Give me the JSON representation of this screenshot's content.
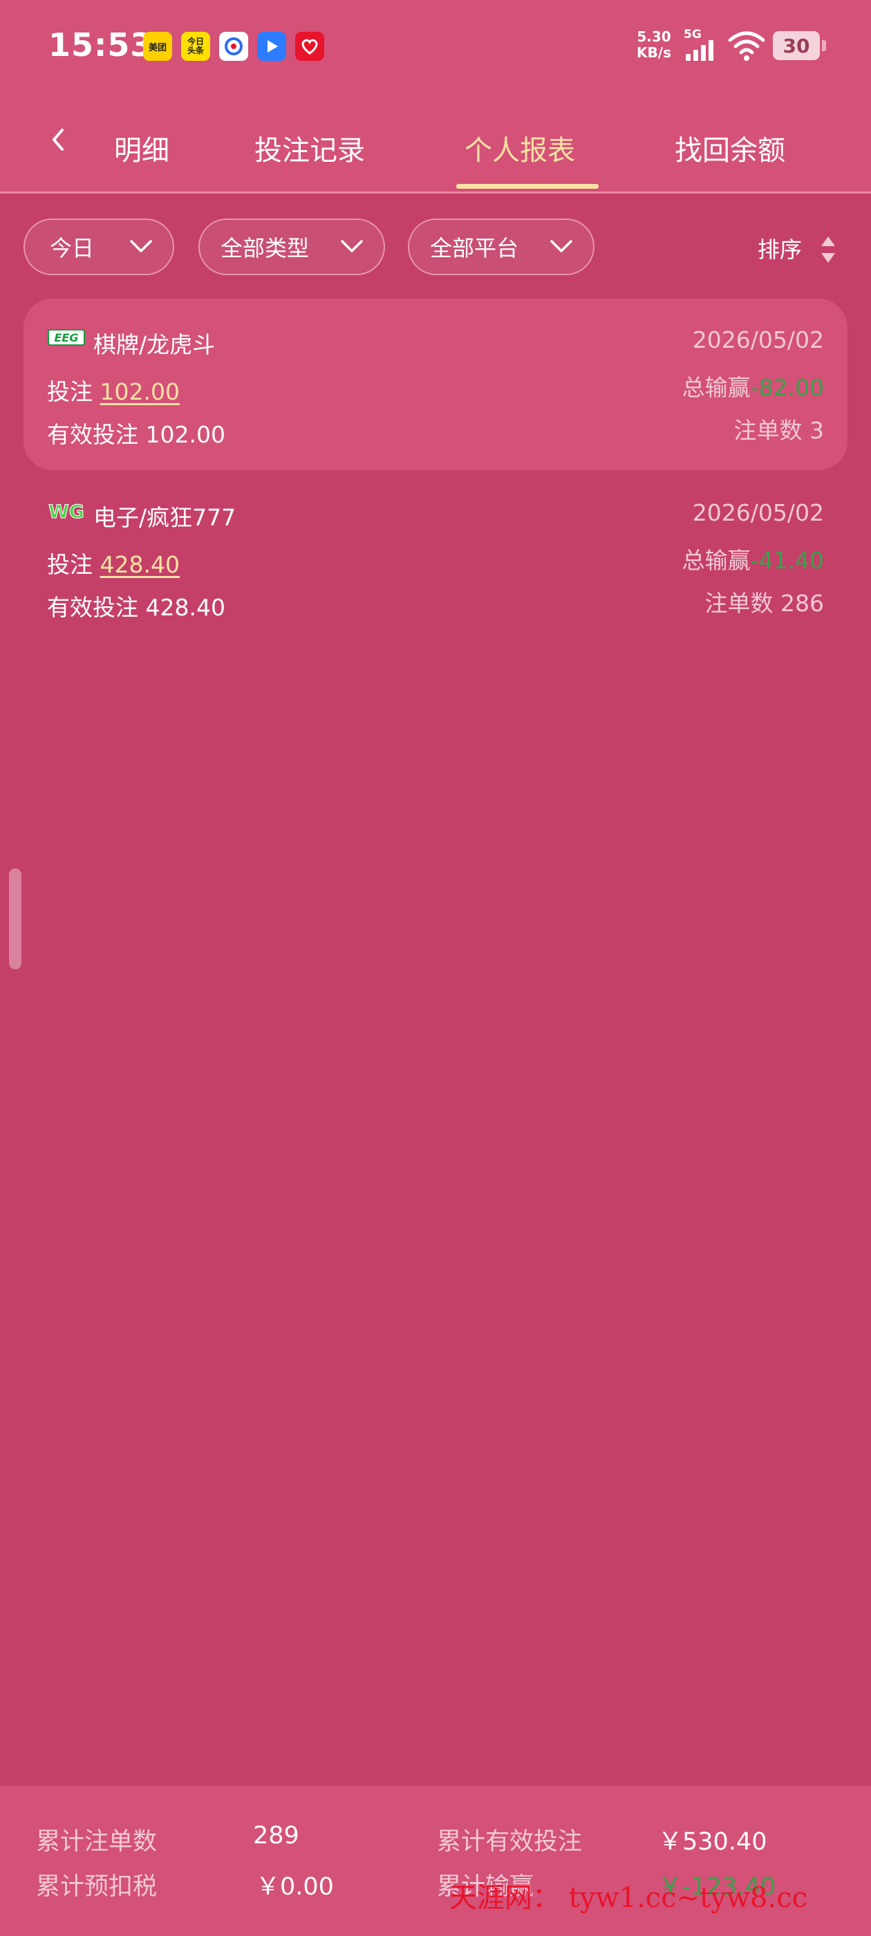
{
  "status_bar": {
    "time": "15:53",
    "net_speed_value": "5.30",
    "net_speed_unit": "KB/s",
    "network": "5G",
    "battery": "30",
    "app_icons": [
      "meituan-icon",
      "toutiao-icon",
      "baidu-icon",
      "video-play-icon",
      "red-app-icon"
    ],
    "meituan_text": "美团",
    "toutiao_text_1": "今日",
    "toutiao_text_2": "头条"
  },
  "tabs": {
    "items": [
      {
        "label": "明细"
      },
      {
        "label": "投注记录"
      },
      {
        "label": "个人报表"
      },
      {
        "label": "找回余额"
      }
    ],
    "active_index": 2,
    "active_color": "#f8e3a2"
  },
  "filters": {
    "date": "今日",
    "type": "全部类型",
    "platform": "全部平台",
    "sort": "排序"
  },
  "records": [
    {
      "logo_text": "EEG",
      "game": "棋牌/龙虎斗",
      "date": "2026/05/02",
      "bet_label": "投注",
      "bet": "102.00",
      "winloss_label": "总输赢",
      "winloss": "-82.00",
      "valid_label": "有效投注",
      "valid_bet": "102.00",
      "count_label": "注单数",
      "count": "3"
    },
    {
      "logo_text": "WG",
      "game": "电子/疯狂777",
      "date": "2026/05/02",
      "bet_label": "投注",
      "bet": "428.40",
      "winloss_label": "总输赢",
      "winloss": "-41.40",
      "valid_label": "有效投注",
      "valid_bet": "428.40",
      "count_label": "注单数",
      "count": "286"
    }
  ],
  "summary": {
    "total_orders_label": "累计注单数",
    "total_orders": "289",
    "total_valid_label": "累计有效投注",
    "total_valid": "￥530.40",
    "total_tax_label": "累计预扣税",
    "total_tax": "￥0.00",
    "total_winloss_label": "累计输赢",
    "total_winloss": "￥-123.40"
  },
  "watermark": {
    "site": "天涯网",
    "separator": "：",
    "url": "tyw1.cc~tyw8.cc"
  },
  "colors": {
    "background": "#c54069",
    "header": "#d45178",
    "accent": "#f8e3a2",
    "loss_green": "#37a14a"
  }
}
